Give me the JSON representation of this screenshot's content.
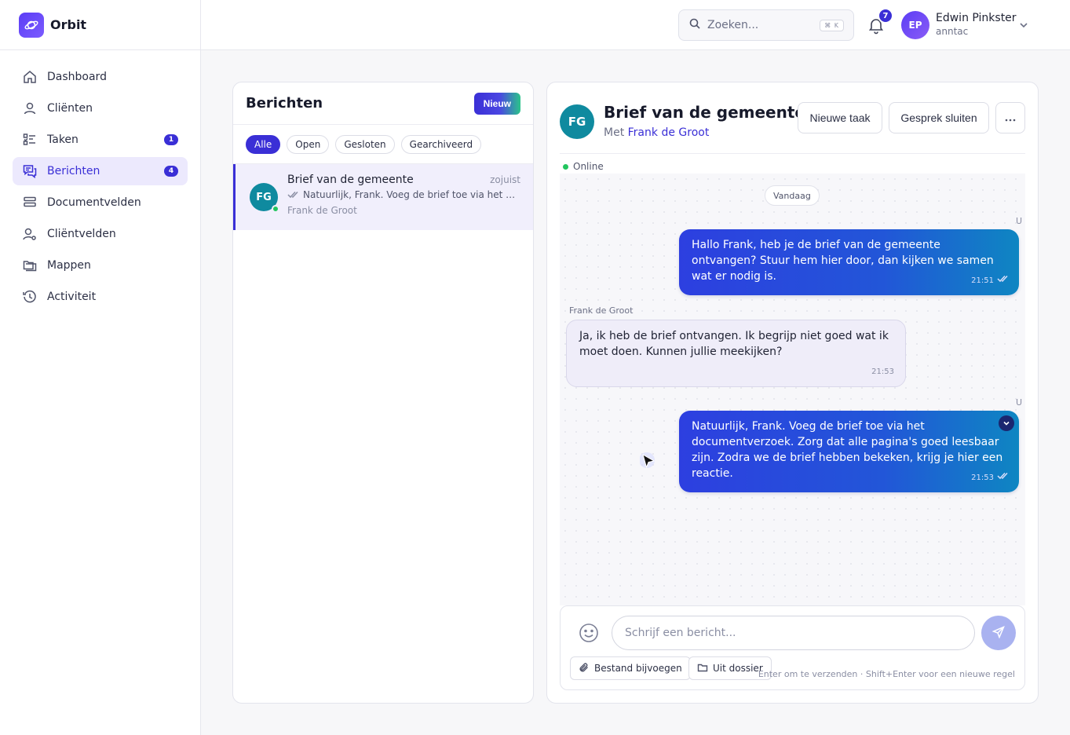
{
  "app": {
    "name": "Orbit"
  },
  "sidebar": {
    "items": [
      {
        "label": "Dashboard",
        "icon": "home-icon"
      },
      {
        "label": "Cliënten",
        "icon": "user-icon"
      },
      {
        "label": "Taken",
        "icon": "task-list-icon",
        "badge": "1"
      },
      {
        "label": "Berichten",
        "icon": "chat-icon",
        "badge": "4",
        "active": true
      },
      {
        "label": "Documentvelden",
        "icon": "fields-icon"
      },
      {
        "label": "Cliëntvelden",
        "icon": "user-settings-icon"
      },
      {
        "label": "Mappen",
        "icon": "folders-icon"
      },
      {
        "label": "Activiteit",
        "icon": "history-icon"
      }
    ]
  },
  "topbar": {
    "search_placeholder": "Zoeken...",
    "search_shortcut": "⌘ K",
    "notification_count": "7",
    "user": {
      "initials": "EP",
      "name": "Edwin Pinkster",
      "org": "anntac"
    }
  },
  "list": {
    "title": "Berichten",
    "new_label": "Nieuw",
    "filters": [
      "Alle",
      "Open",
      "Gesloten",
      "Gearchiveerd"
    ],
    "active_filter": "Alle",
    "conversations": [
      {
        "initials": "FG",
        "title": "Brief van de gemeente",
        "time": "zojuist",
        "preview": "Natuurlijk, Frank. Voeg de brief toe via het documentverzoek. Zorg dat alle pagina's goed leesbaar zijn.",
        "name": "Frank de Groot",
        "online": true
      }
    ]
  },
  "chat": {
    "initials": "FG",
    "title": "Brief van de gemeente",
    "with_prefix": "Met",
    "with_name": "Frank de Groot",
    "actions": {
      "new_task": "Nieuwe taak",
      "close": "Gesprek sluiten",
      "more": "···"
    },
    "status": "Online",
    "day": "Vandaag",
    "messages": [
      {
        "from": "me",
        "sender": "U",
        "text": "Hallo Frank, heb je de brief van de gemeente ontvangen? Stuur hem hier door, dan kijken we samen wat er nodig is.",
        "time": "21:51"
      },
      {
        "from": "them",
        "sender": "Frank de Groot",
        "text": "Ja, ik heb de brief ontvangen. Ik begrijp niet goed wat ik moet doen. Kunnen jullie meekijken?",
        "time": "21:53"
      },
      {
        "from": "me",
        "sender": "U",
        "text": "Natuurlijk, Frank. Voeg de brief toe via het documentverzoek. Zorg dat alle pagina's goed leesbaar zijn. Zodra we de brief hebben bekeken, krijg je hier een reactie.",
        "time": "21:53"
      }
    ],
    "composer": {
      "placeholder": "Schrijf een bericht...",
      "attach_label": "Bestand bijvoegen",
      "dossier_label": "Uit dossier",
      "hint": "Enter om te verzenden · Shift+Enter voor een nieuwe regel"
    }
  },
  "colors": {
    "accent": "#3a2fd6",
    "online": "#22c55e",
    "avatar_teal": "#0f8a9f"
  }
}
